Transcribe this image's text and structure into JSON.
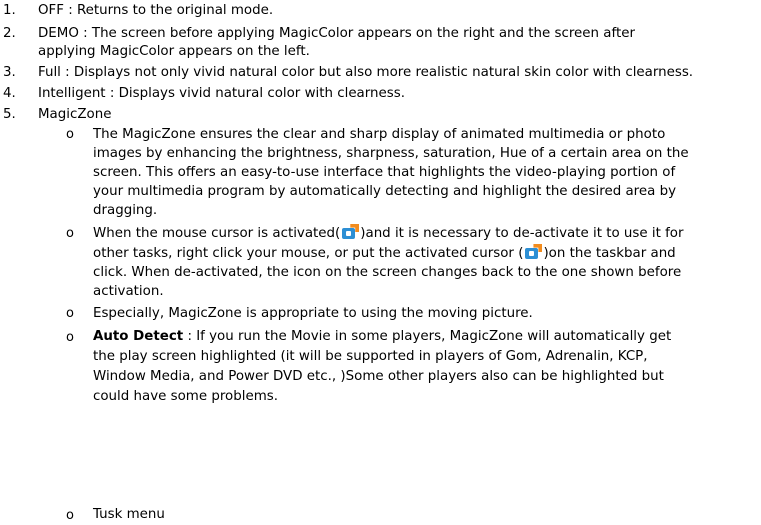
{
  "items": [
    {
      "num": "1.",
      "lines": [
        "OFF : Returns to the original mode."
      ]
    },
    {
      "num": "2.",
      "lines": [
        "DEMO : The screen before applying MagicColor appears on the right and the screen after",
        "applying MagicColor appears on the left."
      ]
    },
    {
      "num": "3.",
      "lines": [
        "Full : Displays not only vivid natural color but also more realistic natural skin color with clearness."
      ]
    },
    {
      "num": "4.",
      "lines": [
        "Intelligent : Displays vivid natural color with clearness."
      ]
    },
    {
      "num": "5.",
      "lines": [
        "MagicZone"
      ]
    }
  ],
  "bullet_glyph": "o",
  "subitems": {
    "s1": [
      "The MagicZone ensures the clear and sharp display of animated multimedia or photo",
      "images by enhancing the brightness, sharpness, saturation, Hue of a certain area on the",
      "screen. This offers an easy-to-use interface that highlights the video-playing portion of",
      "your multimedia program by automatically detecting and highlight the desired area by",
      "dragging."
    ],
    "s2": {
      "l1_a": "When the mouse cursor is activated(",
      "l1_b": ")and it is necessary to de-activate it to use it for",
      "l2_a": "other tasks, right click your mouse, or put the activated cursor (",
      "l2_b": ")on the taskbar and",
      "l3": "click. When de-activated, the icon on the screen changes back to the one shown before",
      "l4": "activation."
    },
    "s3": "Especially, MagicZone is appropriate to using the moving picture.",
    "s4": {
      "bold": "Auto Detect",
      "l1_rest": " : If you run the Movie in some players, MagicZone will automatically get",
      "l2": "the play screen highlighted (it will be supported in players of Gom, Adrenalin, KCP,",
      "l3": "Window Media, and Power DVD etc., )Some other players also can be highlighted but",
      "l4": "could have some problems."
    },
    "s5": "Tusk menu"
  }
}
